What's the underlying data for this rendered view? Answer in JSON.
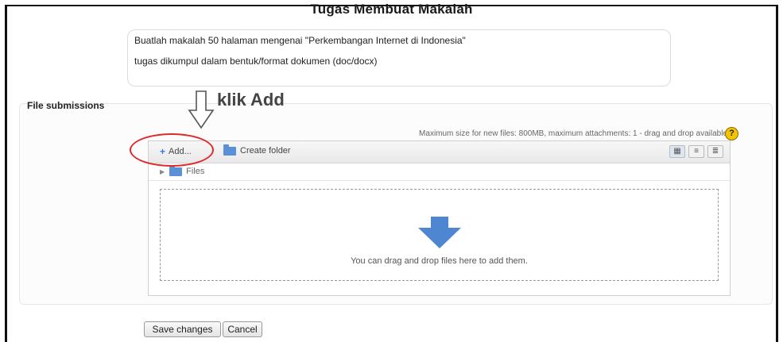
{
  "page_title": "Tugas Membuat Makalah",
  "intro": {
    "line1": "Buatlah makalah 50 halaman mengenai \"Perkembangan Internet di Indonesia\"",
    "line2": "tugas dikumpul dalam bentuk/format dokumen (doc/docx)"
  },
  "section_label": "File submissions",
  "annotation": "klik Add",
  "filepicker": {
    "max_info": "Maximum size for new files: 800MB, maximum attachments: 1 - drag and drop available",
    "help_symbol": "?",
    "add_label": "Add...",
    "create_folder_label": "Create folder",
    "path_label": "Files",
    "drop_text": "You can drag and drop files here to add them.",
    "view_icons": [
      "icons-view-icon",
      "list-view-icon",
      "tree-view-icon"
    ]
  },
  "buttons": {
    "save": "Save changes",
    "cancel": "Cancel"
  },
  "colors": {
    "highlight_circle": "#e02a2a",
    "folder_blue": "#5b8fd6",
    "help_yellow": "#f5c400"
  }
}
